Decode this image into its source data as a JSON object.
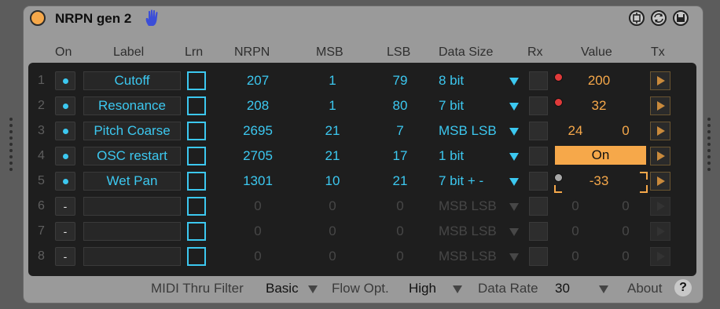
{
  "device": {
    "title": "NRPN gen 2"
  },
  "headers": {
    "on": "On",
    "label": "Label",
    "lrn": "Lrn",
    "nrpn": "NRPN",
    "msb": "MSB",
    "lsb": "LSB",
    "data_size": "Data Size",
    "rx": "Rx",
    "value": "Value",
    "tx": "Tx"
  },
  "rows": [
    {
      "num": "1",
      "on_dot": true,
      "label": "Cutoff",
      "nrpn": "207",
      "msb": "1",
      "lsb": "79",
      "data_size": "8 bit",
      "value": "200",
      "value2": "",
      "active": true
    },
    {
      "num": "2",
      "on_dot": true,
      "label": "Resonance",
      "nrpn": "208",
      "msb": "1",
      "lsb": "80",
      "data_size": "7 bit",
      "value": "32",
      "value2": "",
      "active": true
    },
    {
      "num": "3",
      "on_dot": true,
      "label": "Pitch Coarse",
      "nrpn": "2695",
      "msb": "21",
      "lsb": "7",
      "data_size": "MSB LSB",
      "value": "24",
      "value2": "0",
      "active": true
    },
    {
      "num": "4",
      "on_dot": true,
      "label": "OSC restart",
      "nrpn": "2705",
      "msb": "21",
      "lsb": "17",
      "data_size": "1 bit",
      "value": "On",
      "value2": "",
      "active": true
    },
    {
      "num": "5",
      "on_dot": true,
      "label": "Wet Pan",
      "nrpn": "1301",
      "msb": "10",
      "lsb": "21",
      "data_size": "7 bit + -",
      "value": "-33",
      "value2": "",
      "active": true
    },
    {
      "num": "6",
      "on_dot": false,
      "on_text": "-",
      "label": "",
      "nrpn": "0",
      "msb": "0",
      "lsb": "0",
      "data_size": "MSB LSB",
      "value": "0",
      "value2": "0",
      "active": false
    },
    {
      "num": "7",
      "on_dot": false,
      "on_text": "-",
      "label": "",
      "nrpn": "0",
      "msb": "0",
      "lsb": "0",
      "data_size": "MSB LSB",
      "value": "0",
      "value2": "0",
      "active": false
    },
    {
      "num": "8",
      "on_dot": false,
      "on_text": "-",
      "label": "",
      "nrpn": "0",
      "msb": "0",
      "lsb": "0",
      "data_size": "MSB LSB",
      "value": "0",
      "value2": "0",
      "active": false
    }
  ],
  "footer": {
    "midi_thru_label": "MIDI Thru Filter",
    "midi_thru_value": "Basic",
    "flow_label": "Flow Opt.",
    "flow_value": "High",
    "rate_label": "Data Rate",
    "rate_value": "30",
    "about_label": "About",
    "about_icon": "?"
  },
  "colors": {
    "accent_blue": "#3cc8f0",
    "accent_orange": "#f6a84a",
    "panel": "#1e1e1e"
  }
}
